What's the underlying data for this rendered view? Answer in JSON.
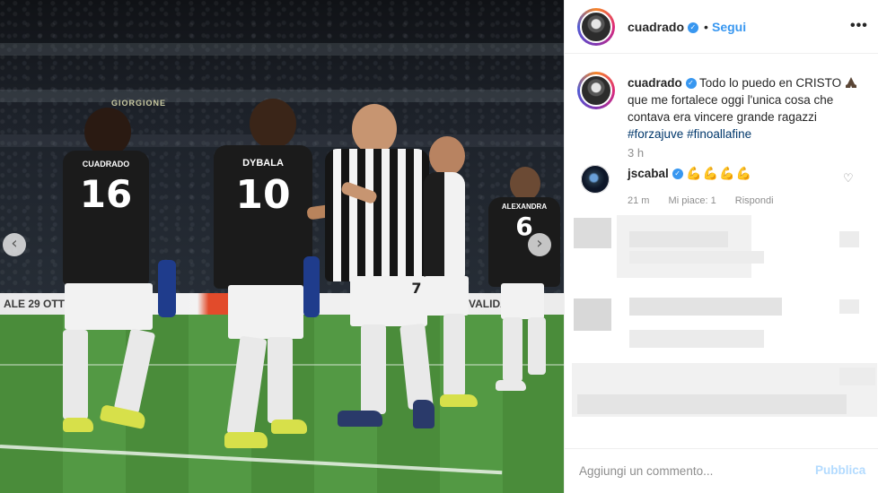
{
  "post": {
    "author": "cuadrado",
    "dot": "•",
    "follow_label": "Segui",
    "more_label": "•••"
  },
  "photo": {
    "stadium_sign": "GIORGIONE",
    "adboard": {
      "left": "ALE 29 OTT",
      "right": "VALIDA"
    },
    "players": [
      {
        "name": "CUADRADO",
        "number": "16"
      },
      {
        "name": "DYBALA",
        "number": "10"
      },
      {
        "name": "",
        "number": "7"
      },
      {
        "name": "ALEXANDRA",
        "number": "6"
      }
    ],
    "prev_icon": "‹",
    "next_icon": "›"
  },
  "caption": {
    "username": "cuadrado",
    "text_1": "Todo lo puedo en CRISTO",
    "text_2": "que me fortalece oggi l'unica cosa che contava era vincere grande ragazzi",
    "hashtag_1": "#forzajuve",
    "hashtag_2": "#finoallafine",
    "time": "3 h"
  },
  "comment": {
    "username": "jscabal",
    "text": "💪💪💪💪",
    "time": "21 m",
    "likes": "Mi piace: 1",
    "reply": "Rispondi",
    "heart_icon": "♡"
  },
  "footer": {
    "placeholder": "Aggiungi un commento...",
    "publish_label": "Pubblica"
  },
  "colors": {
    "link_blue": "#3897f0",
    "publish_disabled": "#b3dbff",
    "hashtag": "#00376b"
  }
}
